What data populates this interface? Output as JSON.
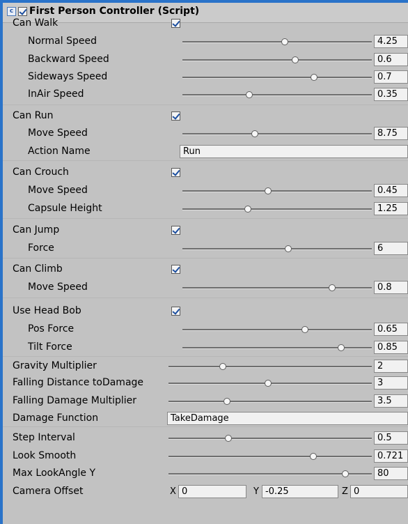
{
  "component": {
    "title": "First Person Controller (Script)",
    "enabled": true
  },
  "rows": [
    {
      "label": "Can Walk",
      "type": "checkbox",
      "checked": true
    },
    {
      "label": "Normal Speed",
      "type": "slider",
      "value": "4.25",
      "fraction": 0.54
    },
    {
      "label": "Backward Speed",
      "type": "slider",
      "value": "0.6",
      "fraction": 0.6
    },
    {
      "label": "Sideways Speed",
      "type": "slider",
      "value": "0.7",
      "fraction": 0.7
    },
    {
      "label": "InAir Speed",
      "type": "slider",
      "value": "0.35",
      "fraction": 0.35
    },
    {
      "label": "Can Run",
      "type": "checkbox",
      "checked": true
    },
    {
      "label": "Move Speed",
      "type": "slider",
      "value": "8.75",
      "fraction": 0.38
    },
    {
      "label": "Action Name",
      "type": "text",
      "value": "Run"
    },
    {
      "label": "Can Crouch",
      "type": "checkbox",
      "checked": true
    },
    {
      "label": "Move Speed",
      "type": "slider",
      "value": "0.45",
      "fraction": 0.45
    },
    {
      "label": "Capsule Height",
      "type": "slider",
      "value": "1.25",
      "fraction": 0.34
    },
    {
      "label": "Can Jump",
      "type": "checkbox",
      "checked": true
    },
    {
      "label": "Force",
      "type": "slider",
      "value": "6",
      "fraction": 0.56
    },
    {
      "label": "Can Climb",
      "type": "checkbox",
      "checked": true
    },
    {
      "label": "Move Speed",
      "type": "slider",
      "value": "0.8",
      "fraction": 0.8
    },
    {
      "label": "Use Head Bob",
      "type": "checkbox",
      "checked": true
    },
    {
      "label": "Pos Force",
      "type": "slider",
      "value": "0.65",
      "fraction": 0.65
    },
    {
      "label": "Tilt Force",
      "type": "slider",
      "value": "0.85",
      "fraction": 0.85
    },
    {
      "label": "Gravity Multiplier",
      "type": "slider",
      "value": "2",
      "fraction": 0.26
    },
    {
      "label": "Falling Distance toDamage",
      "type": "slider",
      "value": "3",
      "fraction": 0.49
    },
    {
      "label": "Falling Damage Multiplier",
      "type": "slider",
      "value": "3.5",
      "fraction": 0.28
    },
    {
      "label": "Damage Function",
      "type": "text",
      "value": "TakeDamage"
    },
    {
      "label": "Step Interval",
      "type": "slider",
      "value": "0.5",
      "fraction": 0.29
    },
    {
      "label": "Look Smooth",
      "type": "slider",
      "value": "0.721",
      "fraction": 0.72
    },
    {
      "label": "Max LookAngle Y",
      "type": "slider",
      "value": "80",
      "fraction": 0.88
    },
    {
      "label": "Camera Offset",
      "type": "vector3",
      "x": "0",
      "y": "-0.25",
      "z": "0"
    }
  ]
}
